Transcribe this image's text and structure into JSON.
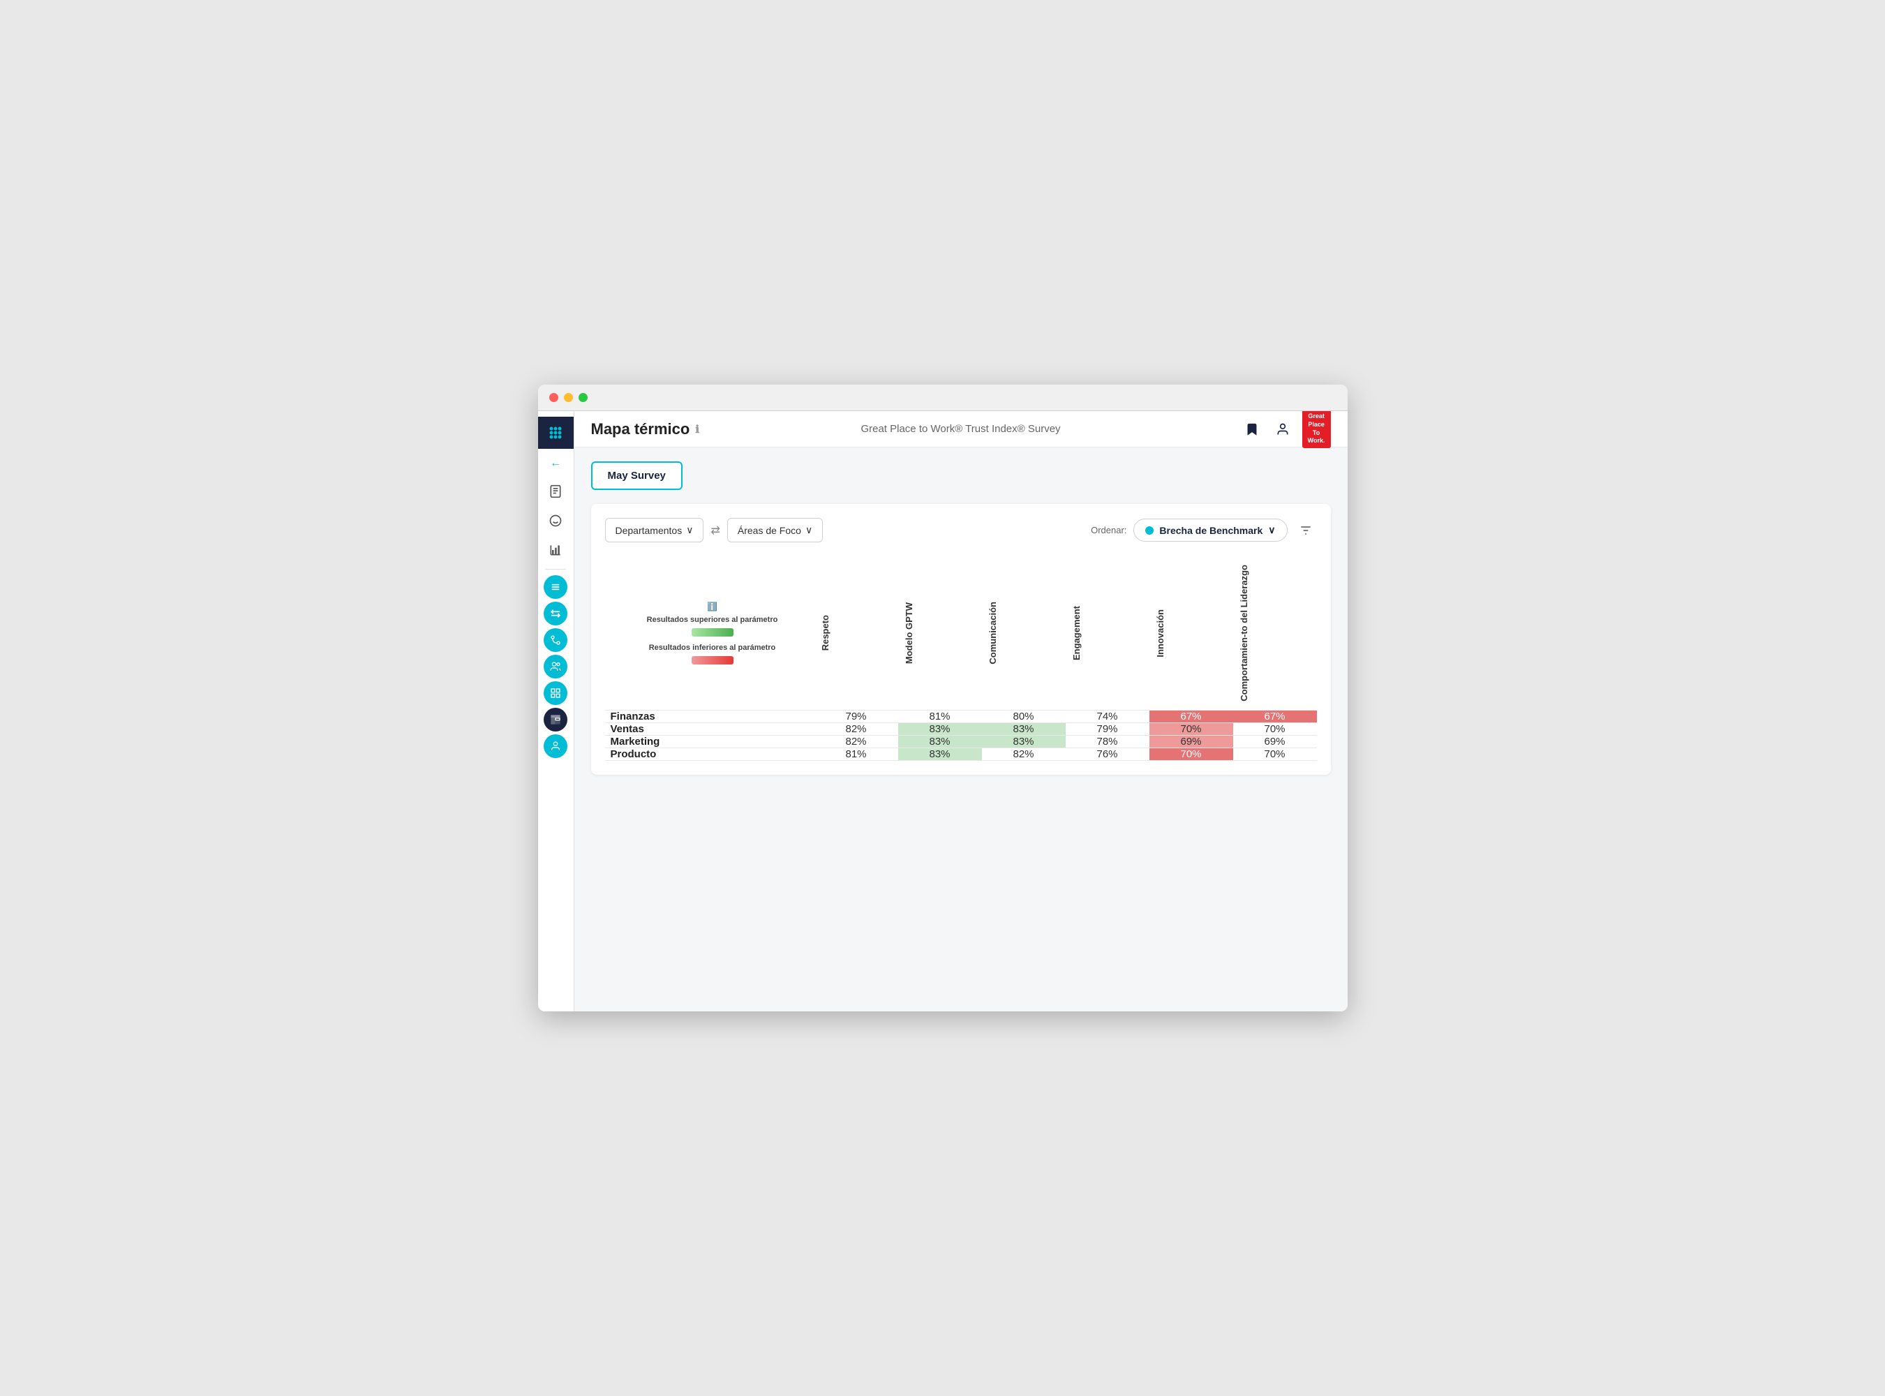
{
  "window": {
    "traffic_lights": [
      "red",
      "yellow",
      "green"
    ]
  },
  "top_bar": {
    "page_title": "Mapa térmico",
    "info_icon": "ℹ",
    "survey_name": "Great Place to Work® Trust Index® Survey",
    "icons": [
      "bookmark",
      "person"
    ]
  },
  "gptw_logo": {
    "line1": "Great",
    "line2": "Place",
    "line3": "To",
    "line4": "Work."
  },
  "sidebar": {
    "items": [
      {
        "name": "grid-dots",
        "icon": "⠿",
        "active": true
      },
      {
        "name": "back-arrow",
        "icon": "←"
      },
      {
        "name": "document",
        "icon": "📋"
      },
      {
        "name": "smiley",
        "icon": "☺"
      },
      {
        "name": "chart",
        "icon": "📊"
      },
      {
        "name": "list1",
        "icon": "≡"
      },
      {
        "name": "arrows",
        "icon": "⇅"
      },
      {
        "name": "flow",
        "icon": "⇄"
      },
      {
        "name": "people",
        "icon": "👥"
      },
      {
        "name": "grid2",
        "icon": "▦"
      },
      {
        "name": "heatmap-active",
        "icon": "📈",
        "circled": true,
        "dark": true
      },
      {
        "name": "person2",
        "icon": "👤"
      }
    ]
  },
  "survey_button": {
    "label": "May Survey"
  },
  "filter_bar": {
    "dropdown1_label": "Departamentos",
    "dropdown1_arrow": "∨",
    "swap_icon": "⇄",
    "dropdown2_label": "Áreas de Foco",
    "dropdown2_arrow": "∨",
    "sort_label": "Ordenar:",
    "sort_option": "Brecha de Benchmark",
    "sort_arrow": "∨",
    "filter_icon": "⊟"
  },
  "legend": {
    "info_icon": "ℹ",
    "above_label": "Resultados superiores al parámetro",
    "below_label": "Resultados inferiores al parámetro"
  },
  "columns": [
    {
      "id": "respeto",
      "label": "Respeto"
    },
    {
      "id": "modelo-gptw",
      "label": "Modelo GPTW"
    },
    {
      "id": "comunicacion",
      "label": "Comunicación"
    },
    {
      "id": "engagement",
      "label": "Engagement"
    },
    {
      "id": "innovacion",
      "label": "Innovación"
    },
    {
      "id": "comportamiento",
      "label": "Comportamien-to del Liderazgo"
    }
  ],
  "rows": [
    {
      "department": "Finanzas",
      "values": [
        {
          "value": "79%",
          "class": "neutral"
        },
        {
          "value": "81%",
          "class": "neutral"
        },
        {
          "value": "80%",
          "class": "neutral"
        },
        {
          "value": "74%",
          "class": "neutral"
        },
        {
          "value": "67%",
          "class": "red-strong"
        },
        {
          "value": "67%",
          "class": "red-strong"
        }
      ]
    },
    {
      "department": "Ventas",
      "values": [
        {
          "value": "82%",
          "class": "neutral"
        },
        {
          "value": "83%",
          "class": "green-light"
        },
        {
          "value": "83%",
          "class": "green-light"
        },
        {
          "value": "79%",
          "class": "neutral"
        },
        {
          "value": "70%",
          "class": "red-medium"
        },
        {
          "value": "70%",
          "class": "neutral"
        }
      ]
    },
    {
      "department": "Marketing",
      "values": [
        {
          "value": "82%",
          "class": "neutral"
        },
        {
          "value": "83%",
          "class": "green-light"
        },
        {
          "value": "83%",
          "class": "green-light"
        },
        {
          "value": "78%",
          "class": "neutral"
        },
        {
          "value": "69%",
          "class": "red-medium"
        },
        {
          "value": "69%",
          "class": "neutral"
        }
      ]
    },
    {
      "department": "Producto",
      "values": [
        {
          "value": "81%",
          "class": "neutral"
        },
        {
          "value": "83%",
          "class": "green-light"
        },
        {
          "value": "82%",
          "class": "neutral"
        },
        {
          "value": "76%",
          "class": "neutral"
        },
        {
          "value": "70%",
          "class": "red-strong"
        },
        {
          "value": "70%",
          "class": "neutral"
        }
      ]
    }
  ]
}
